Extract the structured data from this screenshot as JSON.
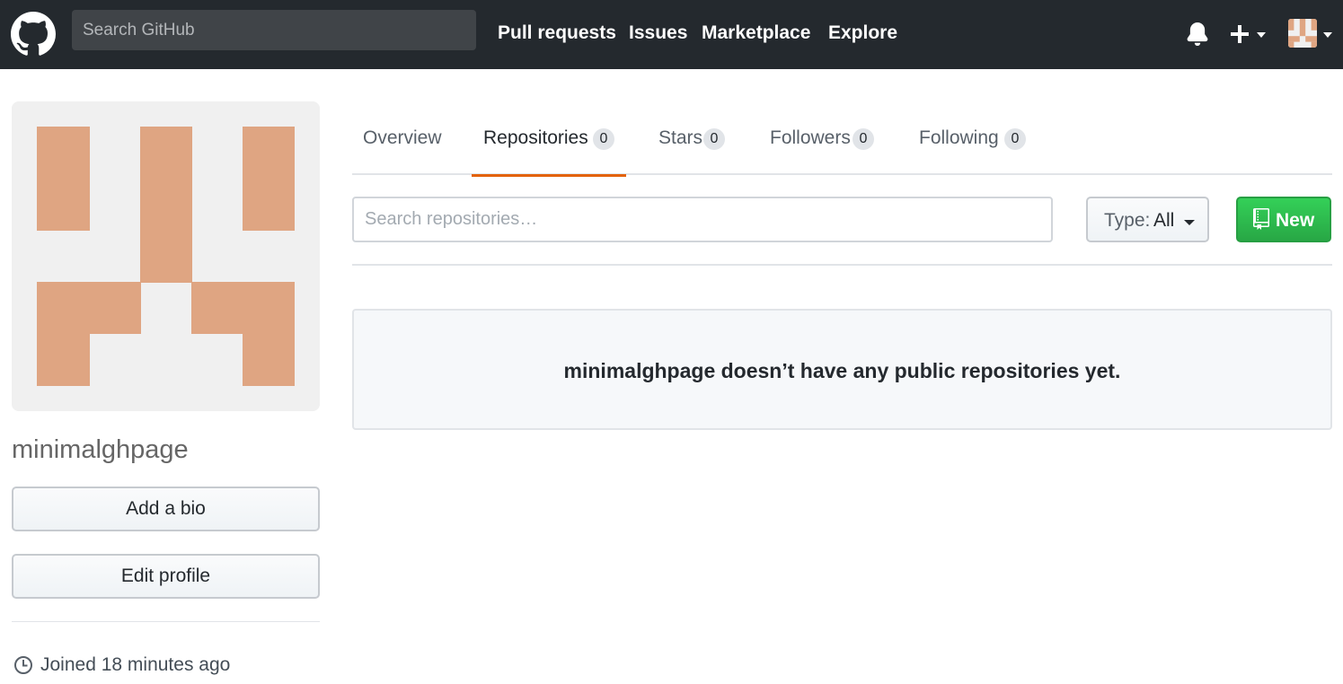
{
  "header": {
    "search_placeholder": "Search GitHub",
    "nav": [
      {
        "label": "Pull requests"
      },
      {
        "label": "Issues"
      },
      {
        "label": "Marketplace"
      },
      {
        "label": "Explore"
      }
    ],
    "icons": [
      "github-logo-icon",
      "bell-icon",
      "plus-icon",
      "chevron-down-icon",
      "avatar"
    ],
    "background": "#24292e"
  },
  "profile": {
    "username": "minimalghpage",
    "avatar_color": "#dfa582",
    "avatar_background": "#f0f0f0",
    "buttons": {
      "add_bio": "Add a bio",
      "edit_profile": "Edit profile"
    },
    "joined": "Joined 18 minutes ago"
  },
  "tabs": [
    {
      "label": "Overview",
      "count": null,
      "selected": false
    },
    {
      "label": "Repositories",
      "count": "0",
      "selected": true
    },
    {
      "label": "Stars",
      "count": "0",
      "selected": false
    },
    {
      "label": "Followers",
      "count": "0",
      "selected": false
    },
    {
      "label": "Following",
      "count": "0",
      "selected": false
    }
  ],
  "filters": {
    "search_placeholder": "Search repositories…",
    "type_prefix": "Type:",
    "type_value": "All",
    "new_label": "New"
  },
  "blankslate": {
    "message": "minimalghpage doesn’t have any public repositories yet."
  },
  "colors": {
    "accent_tab": "#e36209",
    "new_button": "#28a745"
  }
}
